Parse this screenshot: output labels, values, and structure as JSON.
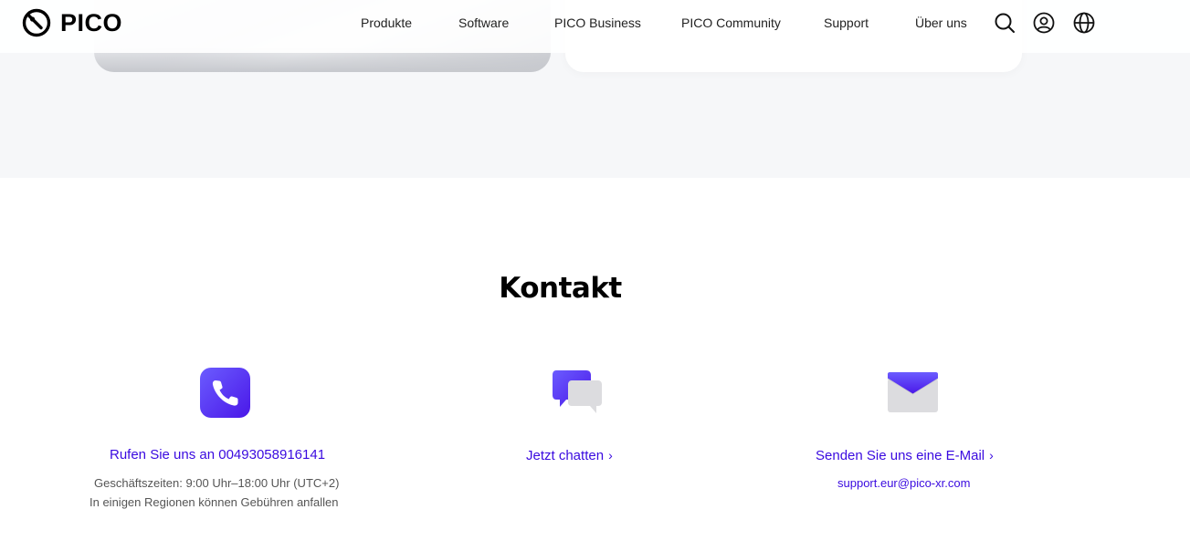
{
  "brand": {
    "name": "PICO"
  },
  "nav": {
    "items": [
      {
        "label": "Produkte"
      },
      {
        "label": "Software"
      },
      {
        "label": "PICO Business"
      },
      {
        "label": "PICO Community"
      },
      {
        "label": "Support"
      },
      {
        "label": "Über uns"
      }
    ],
    "icons": [
      "search-icon",
      "account-icon",
      "globe-icon"
    ]
  },
  "contact": {
    "title": "Kontakt",
    "phone": {
      "icon": "phone-icon",
      "label": "Rufen Sie uns an 00493058916141",
      "hours": "Geschäftszeiten: 9:00 Uhr–18:00 Uhr (UTC+2)",
      "fees": "In einigen Regionen können Gebühren anfallen"
    },
    "chat": {
      "icon": "chat-icon",
      "label": "Jetzt chatten"
    },
    "email": {
      "icon": "mail-icon",
      "label": "Senden Sie uns eine E-Mail",
      "address": "support.eur@pico-xr.com"
    }
  },
  "colors": {
    "accent": "#3a0ae0",
    "band": "#f6f7f9"
  }
}
